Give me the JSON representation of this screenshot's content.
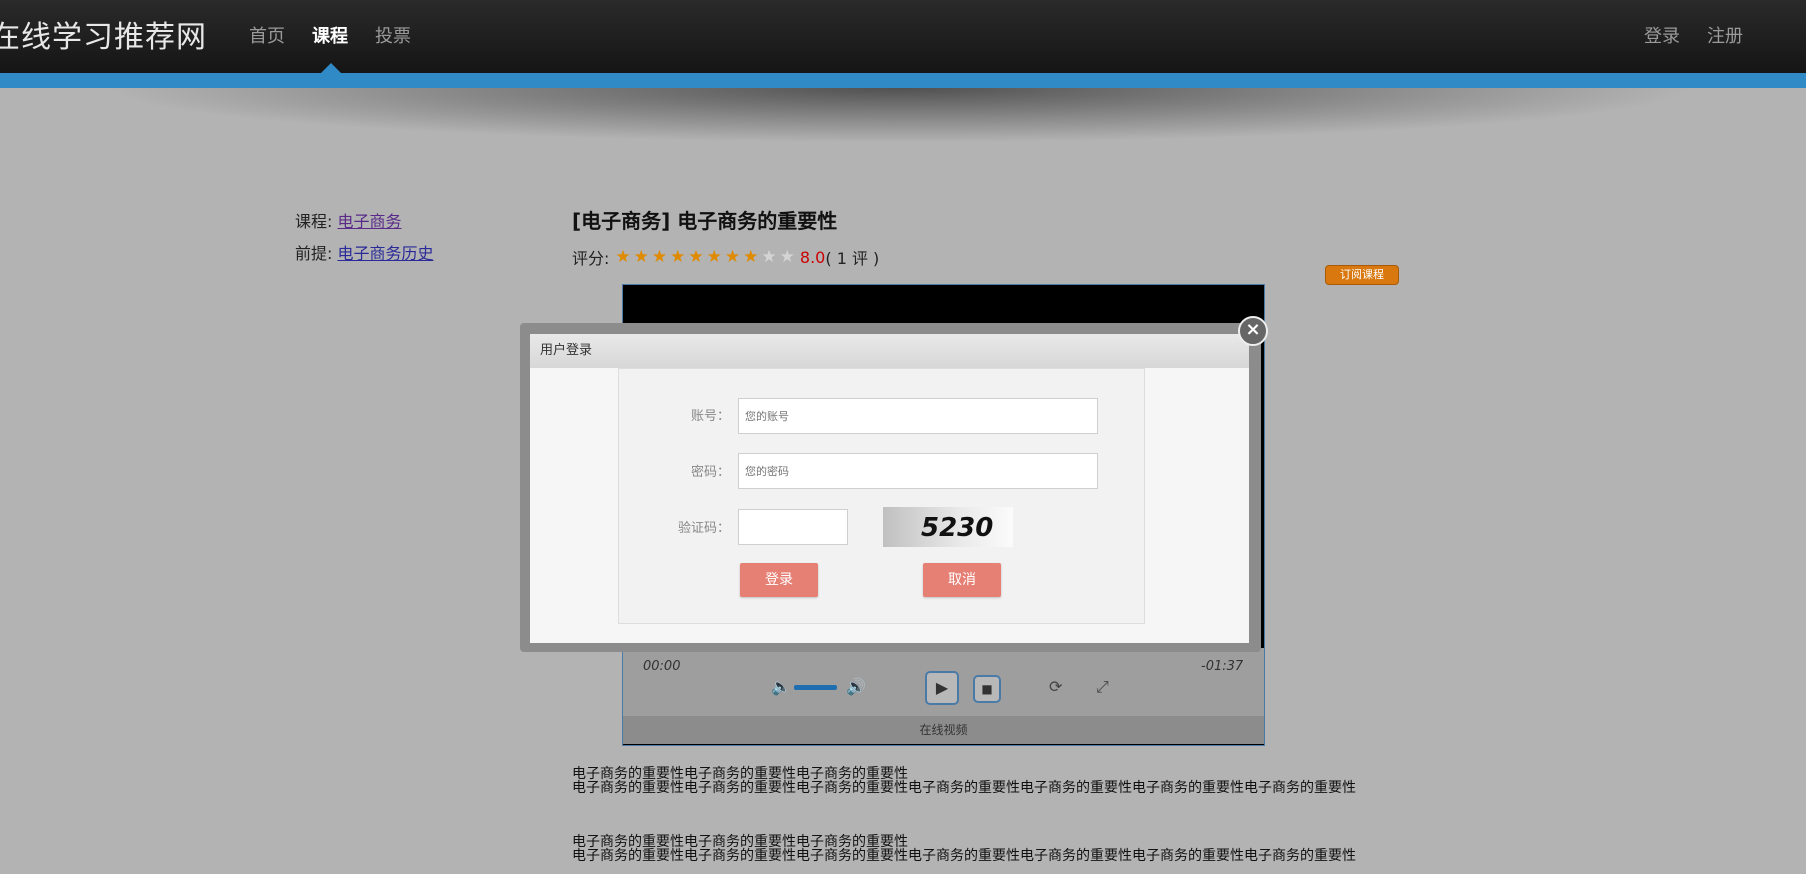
{
  "header": {
    "logo": "在线学习推荐网",
    "nav": [
      "首页",
      "课程",
      "投票"
    ],
    "active_nav": "课程",
    "login": "登录",
    "register": "注册"
  },
  "sidebar": {
    "course_label": "课程:",
    "course_link": "电子商务",
    "prereq_label": "前提:",
    "prereq_link": "电子商务历史"
  },
  "lesson": {
    "title": "[电子商务] 电子商务的重要性",
    "rating_label": "评分:",
    "stars_filled": 8,
    "stars_total": 10,
    "score": "8.0",
    "review_count": "( 1 评 )",
    "subscribe_button": "订阅课程"
  },
  "video": {
    "current_time": "00:00",
    "remaining_time": "-01:37",
    "caption": "在线视频",
    "volume_level": 0.9
  },
  "description": [
    "电子商务的重要性电子商务的重要性电子商务的重要性",
    "电子商务的重要性电子商务的重要性电子商务的重要性电子商务的重要性电子商务的重要性电子商务的重要性电子商务的重要性",
    "电子商务的重要性电子商务的重要性电子商务的重要性",
    "电子商务的重要性电子商务的重要性电子商务的重要性电子商务的重要性电子商务的重要性电子商务的重要性电子商务的重要性"
  ],
  "login_modal": {
    "title": "用户登录",
    "account_label": "账号：",
    "account_placeholder": "您的账号",
    "password_label": "密码：",
    "password_placeholder": "您的密码",
    "captcha_label": "验证码：",
    "captcha_text": "5230",
    "login_button": "登录",
    "cancel_button": "取消"
  },
  "colors": {
    "accent_blue": "#2f8ac6",
    "button_red": "#e67f74",
    "subscribe_orange": "#d8780e",
    "score_red": "#cc0000"
  }
}
